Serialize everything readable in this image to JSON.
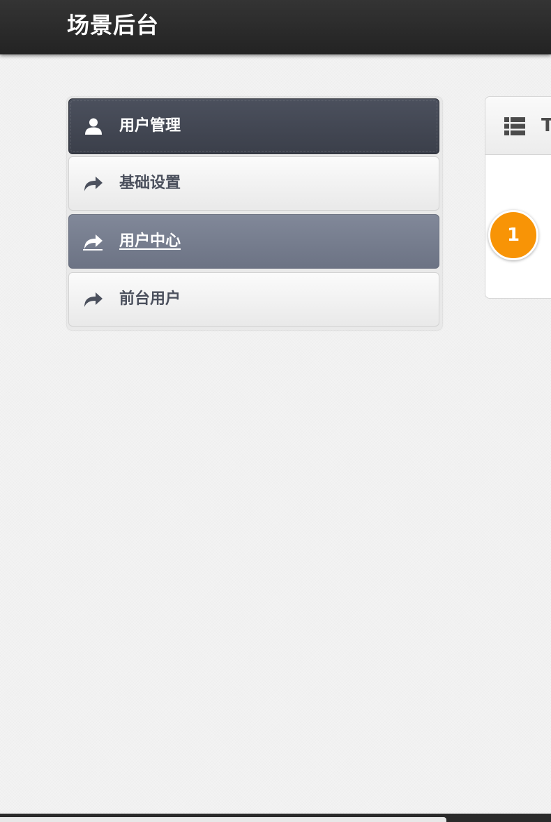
{
  "header": {
    "brand": "场景后台"
  },
  "sidebar": {
    "header_label": "用户管理",
    "header_icon": "user-icon",
    "items": [
      {
        "label": "基础设置",
        "icon": "share-arrow-icon",
        "active": false
      },
      {
        "label": "用户中心",
        "icon": "share-arrow-icon",
        "active": true
      },
      {
        "label": "前台用户",
        "icon": "share-arrow-icon",
        "active": false
      }
    ]
  },
  "panel": {
    "icon": "list-icon",
    "title_partial": "T",
    "badge": "1"
  },
  "colors": {
    "topbar": "#2c2c2c",
    "sidebar_header": "#434854",
    "active_item": "#777e8f",
    "badge": "#f89406"
  }
}
